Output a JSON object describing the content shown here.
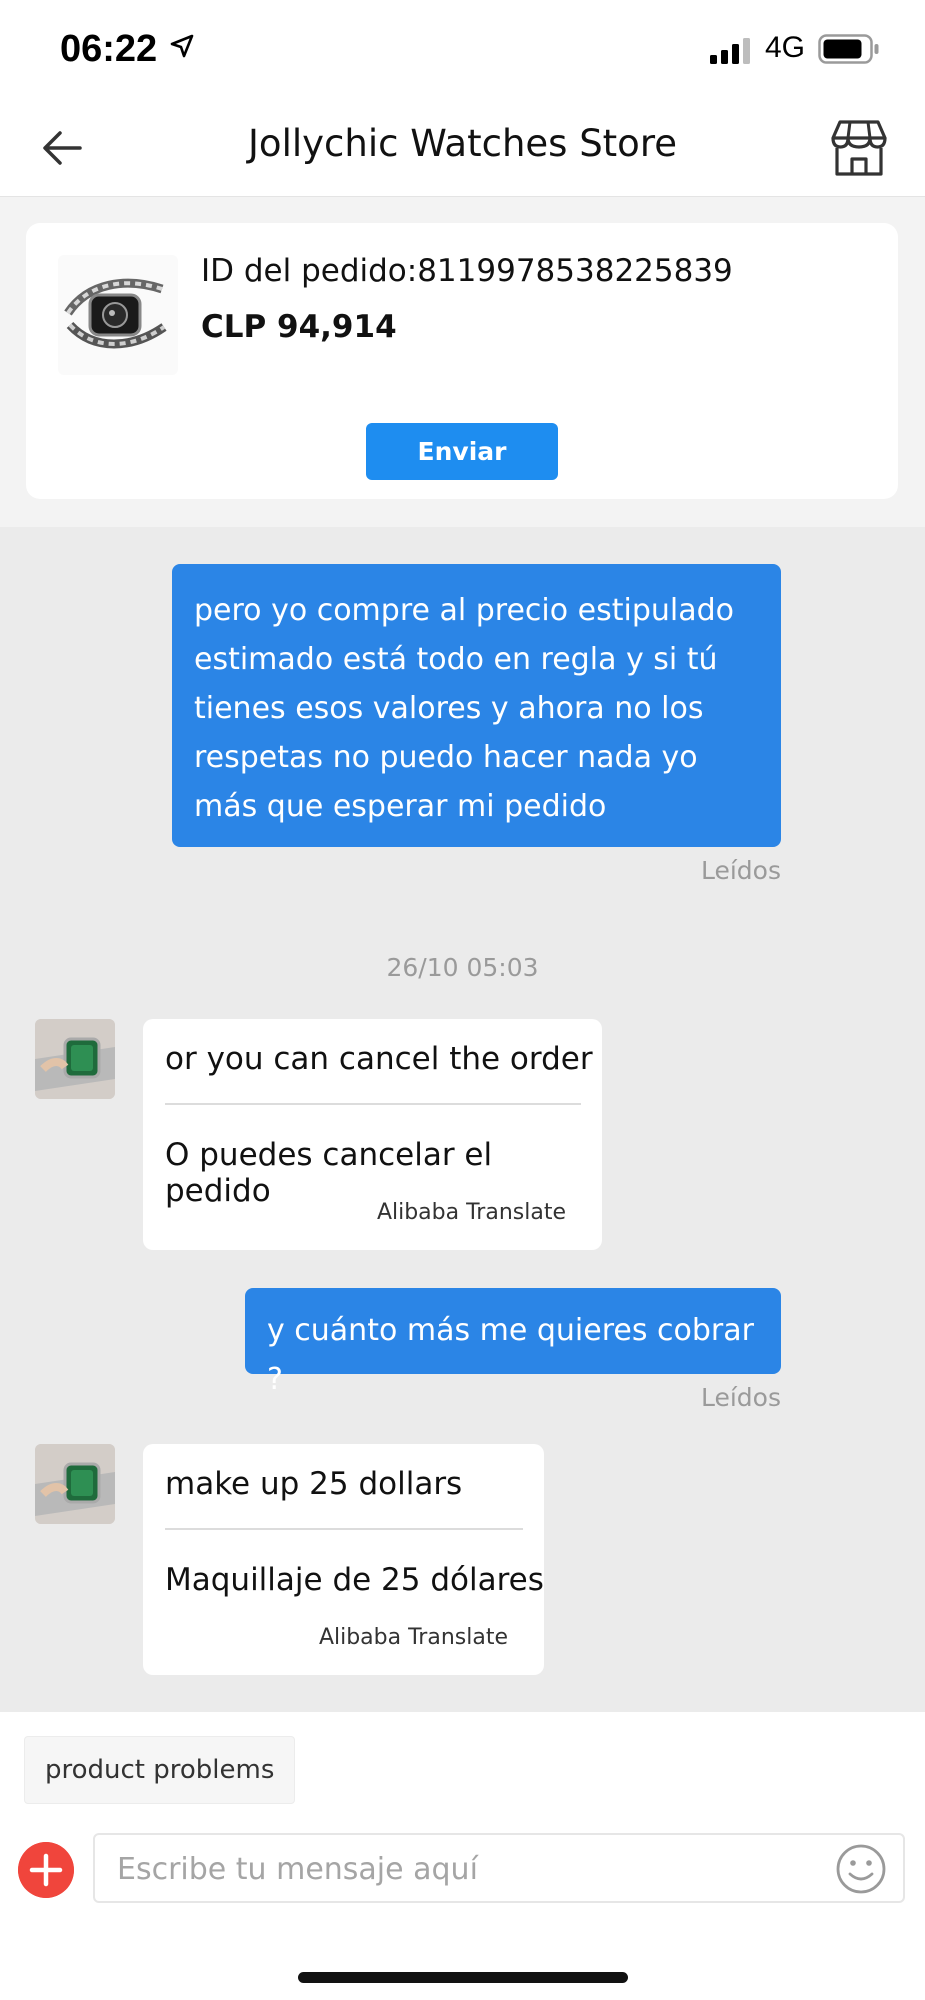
{
  "status_bar": {
    "time": "06:22",
    "network": "4G"
  },
  "header": {
    "title": "Jollychic Watches Store",
    "back_icon": "arrow-left-icon",
    "store_icon": "storefront-icon"
  },
  "order": {
    "id_text": "ID del pedido:8119978538225839",
    "price": "CLP 94,914",
    "send_label": "Enviar"
  },
  "messages": {
    "m1": {
      "text": "pero yo compre al precio estipulado estimado está todo en regla y si tú tienes esos valores y ahora no los respetas no puedo hacer nada yo más que esperar mi pedido",
      "status": "Leídos"
    },
    "timestamp": "26/10 05:03",
    "m2": {
      "original": "or you can cancel the order",
      "translated": "O puedes cancelar el pedido",
      "credit": "Alibaba Translate"
    },
    "m3": {
      "text": "y cuánto más me quieres cobrar ?",
      "status": "Leídos"
    },
    "m4": {
      "original": "make up 25 dollars",
      "translated": "Maquillaje de 25 dólares",
      "credit": "Alibaba Translate"
    }
  },
  "composer": {
    "quick_reply": "product problems",
    "placeholder": "Escribe tu mensaje aquí"
  },
  "colors": {
    "accent_blue": "#1e8df0",
    "bubble_out": "#2b85e6",
    "plus_red": "#f0453c",
    "chat_bg": "#ebebeb"
  }
}
